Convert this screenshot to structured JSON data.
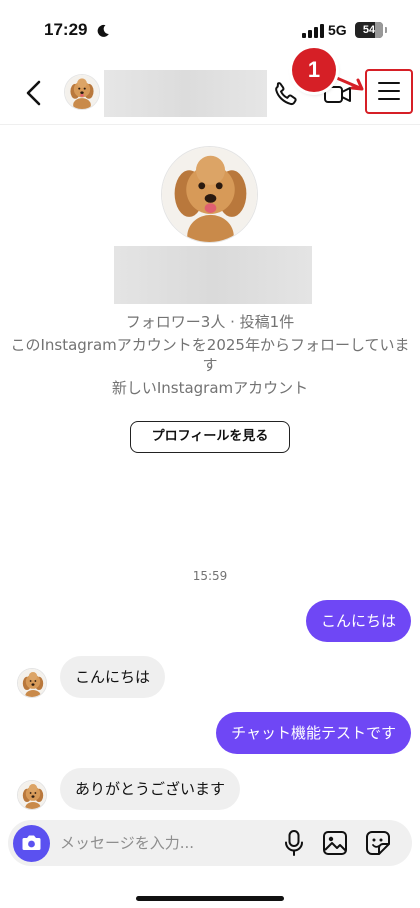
{
  "status_bar": {
    "time": "17:29",
    "network": "5G",
    "battery": "54"
  },
  "header": {
    "icons": [
      "back-icon",
      "phone-icon",
      "video-icon",
      "menu-icon"
    ],
    "annotation_number": "1",
    "annotation_color": "#d61f26"
  },
  "profile": {
    "followers_line": "フォロワー3人 · 投稿1件",
    "since_line": "このInstagramアカウントを2025年からフォローしています",
    "account_type": "新しいInstagramアカウント",
    "view_profile_label": "プロフィールを見る"
  },
  "chat": {
    "timestamp": "15:59",
    "messages": [
      {
        "direction": "sent",
        "text": "こんにちは"
      },
      {
        "direction": "received",
        "text": "こんにちは"
      },
      {
        "direction": "sent",
        "text": "チャット機能テストです"
      },
      {
        "direction": "received",
        "text": "ありがとうございます"
      }
    ],
    "sent_color": "#6f47f5",
    "received_color": "#efefef"
  },
  "composer": {
    "placeholder": "メッセージを入力...",
    "icons": [
      "camera-icon",
      "mic-icon",
      "gallery-icon",
      "sticker-icon"
    ]
  }
}
